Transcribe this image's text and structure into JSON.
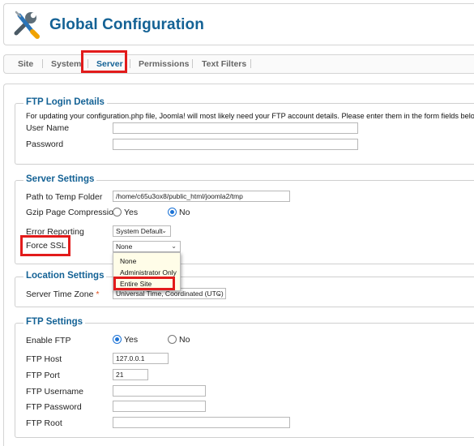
{
  "header": {
    "title": "Global Configuration",
    "logo_icon": "tools-icon"
  },
  "tabs": [
    {
      "label": "Site"
    },
    {
      "label": "System"
    },
    {
      "label": "Server",
      "active": true
    },
    {
      "label": "Permissions"
    },
    {
      "label": "Text Filters"
    }
  ],
  "ftp_login": {
    "legend": "FTP Login Details",
    "description": "For updating your configuration.php file, Joomla! will most likely need your FTP account details. Please enter them in the form fields below.",
    "username_label": "User Name",
    "username_value": "",
    "password_label": "Password",
    "password_value": ""
  },
  "server_settings": {
    "legend": "Server Settings",
    "temp_label": "Path to Temp Folder",
    "temp_value": "/home/c65u3ox8/public_html/joomla2/tmp",
    "gzip_label": "Gzip Page Compression",
    "gzip_yes": "Yes",
    "gzip_no": "No",
    "gzip_selected": "No",
    "error_label": "Error Reporting",
    "error_value": "System Default",
    "ssl_label": "Force SSL",
    "ssl_value": "None",
    "ssl_options": [
      "None",
      "Administrator Only",
      "Entire Site"
    ],
    "ssl_highlighted": "Entire Site"
  },
  "location_settings": {
    "legend": "Location Settings",
    "timezone_label": "Server Time Zone",
    "required_mark": "*",
    "timezone_value": "Universal Time, Coordinated (UTC)"
  },
  "ftp_settings": {
    "legend": "FTP Settings",
    "enable_label": "Enable FTP",
    "enable_yes": "Yes",
    "enable_no": "No",
    "enable_selected": "Yes",
    "host_label": "FTP Host",
    "host_value": "127.0.0.1",
    "port_label": "FTP Port",
    "port_value": "21",
    "username_label": "FTP Username",
    "username_value": "",
    "password_label": "FTP Password",
    "password_value": "",
    "root_label": "FTP Root",
    "root_value": ""
  },
  "colors": {
    "accent": "#146295",
    "highlight": "#e21b1b",
    "radio": "#1c73d6",
    "dropdown_bg": "#fffde8"
  }
}
